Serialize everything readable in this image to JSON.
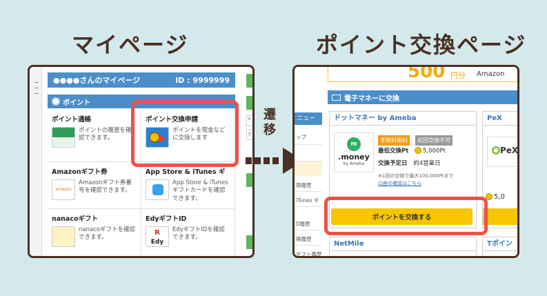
{
  "titles": {
    "left": "マイページ",
    "right": "ポイント交換ページ"
  },
  "transition_label": [
    "遷",
    "移"
  ],
  "left": {
    "header_user": "●●●●さんのマイページ",
    "header_id": "ID : 9999999",
    "section": "ポイント",
    "cells": [
      {
        "title": "ポイント通帳",
        "desc": "ポイントの履歴を確認できます。"
      },
      {
        "title": "ポイント交換申請",
        "desc": "ポイントを現金などに交換します"
      },
      {
        "title": "Amazonギフト券",
        "desc": "Amazonギフト券番号を確認できます。"
      },
      {
        "title": "App Store & iTunes ギ",
        "desc": "App Store & iTunesギフトカードを確認できます。"
      },
      {
        "title": "nanacoギフト",
        "desc": "nanacoギフトを確認できます。"
      },
      {
        "title": "EdyギフトID",
        "desc": "EdyギフトIDを確認できます。"
      }
    ],
    "side_marks": [
      "※",
      "ボ"
    ]
  },
  "right": {
    "banner_amount": "500",
    "banner_unit": "円分",
    "banner_brand": "Amazon",
    "menu": "ニュー",
    "side_items": [
      "ップ",
      "",
      "",
      "",
      "換履歴",
      "iTunes ギ",
      "",
      "D履歴",
      "換履歴",
      "ギフト履歴"
    ],
    "section": "電子マネーに交換",
    "card1": {
      "title": "ドットマネー by Ameba",
      "tag1": "手数料無料",
      "tag2": "初回交換不可",
      "min_label": "最低交換Pt",
      "min_value": "5,000Pt",
      "schedule_label": "交換予定日",
      "schedule_value": "約4営業日",
      "note": "※1回の交換で最大100,000Ptまで",
      "link": "口座の確認はこちら",
      "logo_name": ".money",
      "logo_sub": "by Ameba",
      "button": "ポイントを交換する"
    },
    "card2": {
      "title": "PeX",
      "amount": "5,0",
      "logo": "PeX"
    },
    "card3": {
      "title": "NetMile"
    },
    "card4": {
      "title": "Tポイン"
    }
  },
  "colors": {
    "accent_blue": "#4b8ec9",
    "highlight": "#f0504a",
    "button_yellow": "#f7c600",
    "title_brown": "#4a2f24",
    "background": "#d3e9ec"
  }
}
